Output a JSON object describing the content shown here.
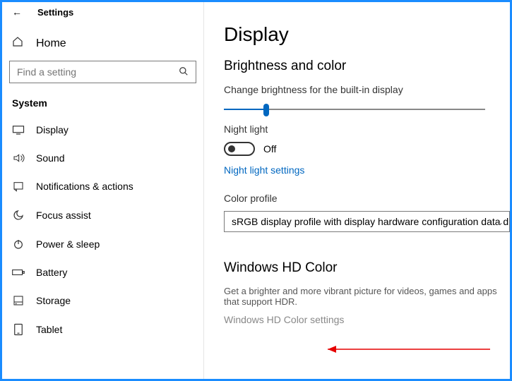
{
  "header": {
    "back_label": "Settings"
  },
  "sidebar": {
    "home_label": "Home",
    "search_placeholder": "Find a setting",
    "section_label": "System",
    "items": [
      {
        "label": "Display"
      },
      {
        "label": "Sound"
      },
      {
        "label": "Notifications & actions"
      },
      {
        "label": "Focus assist"
      },
      {
        "label": "Power & sleep"
      },
      {
        "label": "Battery"
      },
      {
        "label": "Storage"
      },
      {
        "label": "Tablet"
      }
    ]
  },
  "main": {
    "title": "Display",
    "brightness_section": "Brightness and color",
    "brightness_label": "Change brightness for the built-in display",
    "night_light_label": "Night light",
    "night_light_state": "Off",
    "night_light_link": "Night light settings",
    "color_profile_label": "Color profile",
    "color_profile_value": "sRGB display profile with display hardware configuration data d...",
    "hd_section": "Windows HD Color",
    "hd_desc": "Get a brighter and more vibrant picture for videos, games and apps that support HDR.",
    "hd_link": "Windows HD Color settings"
  }
}
